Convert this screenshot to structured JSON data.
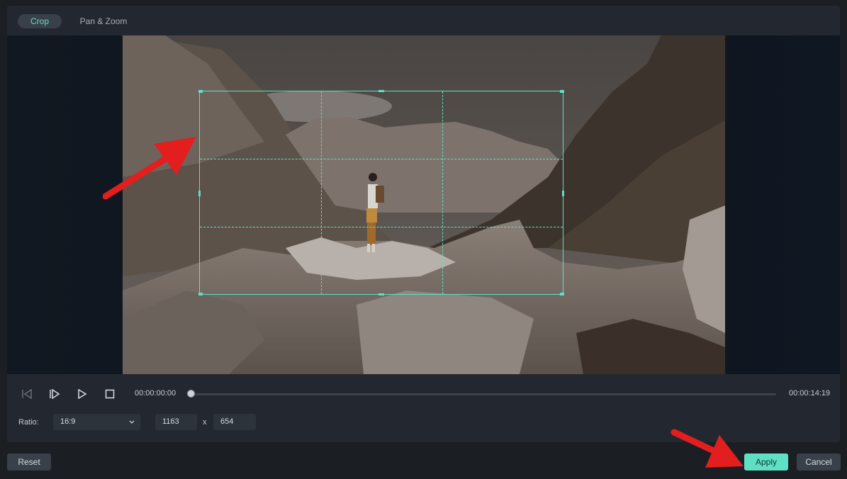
{
  "tabs": [
    {
      "label": "Crop",
      "active": true
    },
    {
      "label": "Pan & Zoom",
      "active": false
    }
  ],
  "player": {
    "current_time": "00:00:00:00",
    "total_time": "00:00:14:19",
    "progress": 0,
    "icons": [
      "step-back-icon",
      "step-forward-icon",
      "play-icon",
      "stop-icon"
    ]
  },
  "crop": {
    "ratio_label": "Ratio:",
    "ratio_value": "16:9",
    "width": "1163",
    "separator": "x",
    "height": "654"
  },
  "footer": {
    "reset": "Reset",
    "apply": "Apply",
    "cancel": "Cancel"
  },
  "colors": {
    "accent": "#5fe0c4",
    "annotation_arrow": "#e31e1e",
    "panel": "#232830",
    "background": "#1b1e23"
  }
}
